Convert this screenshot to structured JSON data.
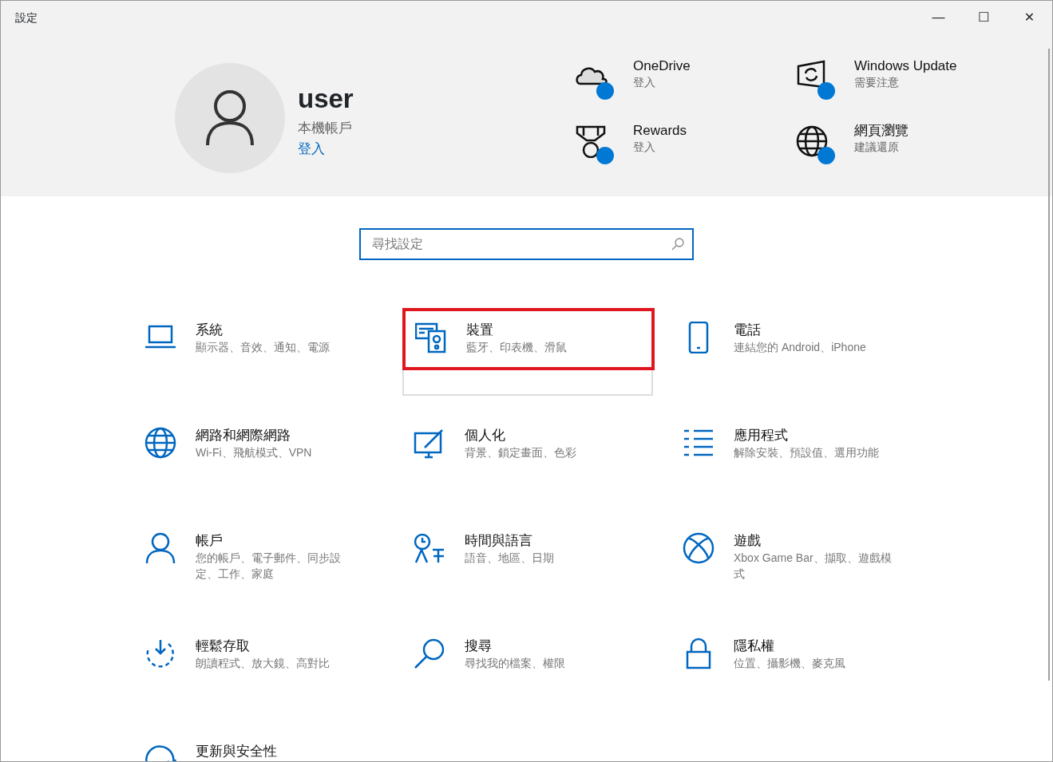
{
  "window": {
    "title": "設定",
    "controls": [
      "—",
      "☐",
      "✕"
    ]
  },
  "account": {
    "name": "user",
    "type": "本機帳戶",
    "link": "登入"
  },
  "quick_links": [
    {
      "title": "OneDrive",
      "subtitle": "登入",
      "badge": true
    },
    {
      "title": "Windows Update",
      "subtitle": "需要注意",
      "badge": true
    },
    {
      "title": "Rewards",
      "subtitle": "登入",
      "badge": true
    },
    {
      "title": "網頁瀏覽",
      "subtitle": "建議還原",
      "badge": true
    }
  ],
  "search": {
    "placeholder": "尋找設定"
  },
  "categories": [
    {
      "title": "系統",
      "description": "顯示器、音效、通知、電源",
      "highlighted": false
    },
    {
      "title": "裝置",
      "description": "藍牙、印表機、滑鼠",
      "highlighted": true
    },
    {
      "title": "電話",
      "description": "連結您的 Android、iPhone",
      "highlighted": false
    },
    {
      "title": "網路和網際網路",
      "description": "Wi-Fi、飛航模式、VPN",
      "highlighted": false
    },
    {
      "title": "個人化",
      "description": "背景、鎖定畫面、色彩",
      "highlighted": false
    },
    {
      "title": "應用程式",
      "description": "解除安裝、預設值、選用功能",
      "highlighted": false
    },
    {
      "title": "帳戶",
      "description": "您的帳戶、電子郵件、同步設定、工作、家庭",
      "highlighted": false
    },
    {
      "title": "時間與語言",
      "description": "語音、地區、日期",
      "highlighted": false
    },
    {
      "title": "遊戲",
      "description": "Xbox Game Bar、擷取、遊戲模式",
      "highlighted": false
    },
    {
      "title": "輕鬆存取",
      "description": "朗讀程式、放大鏡、高對比",
      "highlighted": false
    },
    {
      "title": "搜尋",
      "description": "尋找我的檔案、權限",
      "highlighted": false
    },
    {
      "title": "隱私權",
      "description": "位置、攝影機、麥克風",
      "highlighted": false
    },
    {
      "title": "更新與安全性",
      "highlighted": false
    }
  ]
}
